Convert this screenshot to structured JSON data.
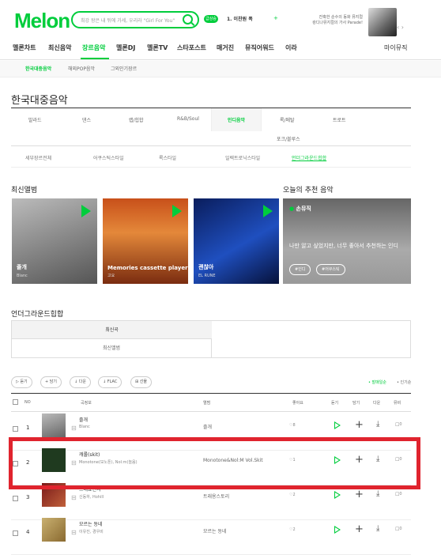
{
  "header": {
    "logo": "Melon",
    "search_placeholder": "최강 왕은 내 뒤에 가세, 우리라 \"Girl For You\"",
    "realtime_badge": "급상승",
    "hot_keyword": "1. 이찬원 폭",
    "promo_line1": "잔혹한 순수의 동화 뮤지컬",
    "promo_line2": "캉디나뮤지컬의 가사 Parade!",
    "promo_arrows": "‹ ›"
  },
  "gnb": {
    "items": [
      "멜론차트",
      "최신음악",
      "장르음악",
      "멜론DJ",
      "멜론TV",
      "스타포스트",
      "매거진",
      "뮤직어워드",
      "이라"
    ],
    "right": "마이뮤직"
  },
  "subnav": {
    "items": [
      "한국대중음악",
      "해외POP음악",
      "그외인기장르"
    ]
  },
  "page_title": "한국대중음악",
  "genre_grid": {
    "row1": [
      "발라드",
      "댄스",
      "랩/힙합",
      "R&B/Soul",
      "인디음악",
      "록/메탈",
      "트로트"
    ],
    "row2": [
      "포크/블루스"
    ]
  },
  "genre_sub": {
    "items": [
      "세부장르전체",
      "어쿠스틱스타일",
      "록스타일",
      "일렉트로닉스타일",
      "언더그라운드힙합"
    ]
  },
  "sections": {
    "latest_album": "최신앨범",
    "today_rec": "오늘의 추천 음악"
  },
  "albums": [
    {
      "title": "졸개",
      "artist": "Blanc"
    },
    {
      "title": "Memories cassette player",
      "artist": "고요"
    },
    {
      "title": "괜찮아",
      "artist": "EL RUNE"
    }
  ],
  "recommendation": {
    "user": "손뮤직",
    "text": "나만 알고 싶었지만, 너무 좋아서 추천하는 인디",
    "tags": [
      "#인디",
      "#어쿠스틱"
    ]
  },
  "underground": {
    "title": "언더그라운드힙합",
    "tabs": [
      "최신곡",
      "최신앨범"
    ]
  },
  "toolbar": {
    "buttons": [
      "듣기",
      "담기",
      "다운",
      "FLAC",
      "선물"
    ],
    "right_on": "발매일순",
    "right_off": "인기순"
  },
  "table": {
    "headers": [
      "NO",
      "곡정보",
      "앨범",
      "좋아요",
      "듣기",
      "담기",
      "다운",
      "뮤비"
    ],
    "rows": [
      {
        "no": "1",
        "title": "졸개",
        "artist": "Blanc",
        "album": "졸개",
        "likes": "8",
        "mv": "0"
      },
      {
        "no": "2",
        "title": "캐롤(skit)",
        "artist": "Monotone(모노톤), Nol:m(놀음)",
        "album": "Monotone&Nol:M Vol.Skit",
        "likes": "1",
        "mv": "0"
      },
      {
        "no": "3",
        "title": "트래표전시",
        "artist": "신동하, Hohill",
        "album": "트래용스토리",
        "likes": "2",
        "mv": "0"
      },
      {
        "no": "4",
        "title": "모르는 동네",
        "artist": "이유진, 경우비",
        "album": "모르는 동네",
        "likes": "2",
        "mv": "0"
      }
    ]
  },
  "colors": {
    "brand": "#00cd3c",
    "highlight_box": "#e0242e"
  }
}
